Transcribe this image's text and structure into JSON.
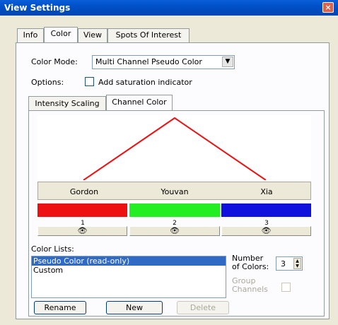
{
  "window": {
    "title": "View Settings",
    "close_glyph": "×"
  },
  "tabs": [
    "Info",
    "Color",
    "View",
    "Spots Of Interest"
  ],
  "color_mode": {
    "label": "Color Mode:",
    "value": "Multi Channel Pseudo Color"
  },
  "options": {
    "label": "Options:",
    "checkbox_label": "Add saturation indicator",
    "checked": false
  },
  "inner_tabs": [
    "Intensity Scaling",
    "Channel Color"
  ],
  "channels": [
    {
      "name": "Gordon",
      "number": "1",
      "color": "#ee1111",
      "eye": "👁"
    },
    {
      "name": "Youvan",
      "number": "2",
      "color": "#22ee22",
      "eye": "👁"
    },
    {
      "name": "Xia",
      "number": "3",
      "color": "#1111dd",
      "eye": "👁"
    }
  ],
  "plot_line_color": "#ee1111",
  "color_lists": {
    "label": "Color Lists:",
    "items": [
      "Pseudo Color (read-only)",
      "Custom"
    ],
    "selected_index": 0
  },
  "number_of_colors": {
    "label_line1": "Number",
    "label_line2": "of Colors:",
    "value": "3"
  },
  "group_channels": {
    "label_line1": "Group",
    "label_line2": "Channels",
    "checked": false
  },
  "buttons": {
    "rename": "Rename",
    "new": "New",
    "delete": "Delete"
  }
}
